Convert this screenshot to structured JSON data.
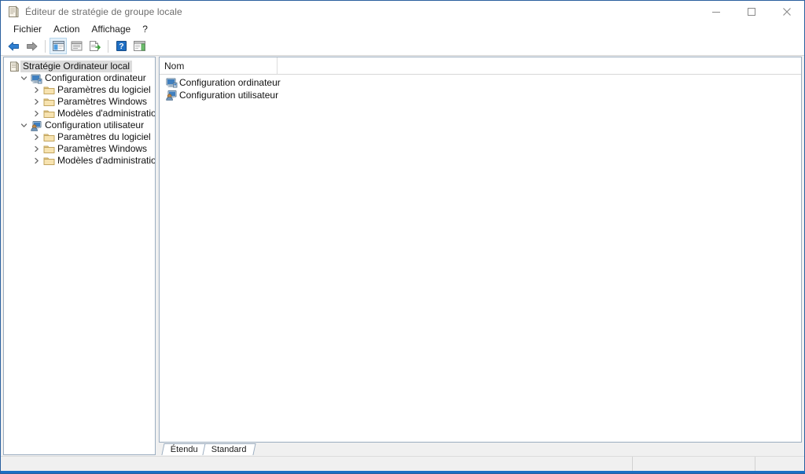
{
  "window": {
    "title": "Éditeur de stratégie de groupe locale",
    "title_icon": "policy-document-icon",
    "controls": {
      "minimize": "minimize-icon",
      "maximize": "maximize-icon",
      "close": "close-icon"
    }
  },
  "menubar": {
    "items": [
      {
        "label": "Fichier"
      },
      {
        "label": "Action"
      },
      {
        "label": "Affichage"
      },
      {
        "label": "?"
      }
    ]
  },
  "toolbar": {
    "buttons": [
      {
        "name": "back-arrow-icon",
        "label": "Précédent"
      },
      {
        "name": "forward-arrow-icon",
        "label": "Suivant"
      },
      {
        "name": "show-hide-tree-icon",
        "label": "Afficher/Masquer l'arborescence"
      },
      {
        "name": "properties-icon",
        "label": "Propriétés"
      },
      {
        "name": "export-list-icon",
        "label": "Exporter la liste"
      },
      {
        "name": "help-icon",
        "label": "Aide"
      },
      {
        "name": "show-action-pane-icon",
        "label": "Afficher le volet Actions"
      }
    ]
  },
  "tree": {
    "nodes": [
      {
        "label": "Stratégie Ordinateur local",
        "icon": "policy-document-icon",
        "indent": 0,
        "twisty": "none",
        "selected": true
      },
      {
        "label": "Configuration ordinateur",
        "icon": "computer-config-icon",
        "indent": 1,
        "twisty": "expanded",
        "selected": false
      },
      {
        "label": "Paramètres du logiciel",
        "icon": "folder-icon",
        "indent": 2,
        "twisty": "collapsed",
        "selected": false
      },
      {
        "label": "Paramètres Windows",
        "icon": "folder-icon",
        "indent": 2,
        "twisty": "collapsed",
        "selected": false
      },
      {
        "label": "Modèles d'administration",
        "icon": "folder-icon",
        "indent": 2,
        "twisty": "collapsed",
        "selected": false
      },
      {
        "label": "Configuration utilisateur",
        "icon": "user-config-icon",
        "indent": 1,
        "twisty": "expanded",
        "selected": false
      },
      {
        "label": "Paramètres du logiciel",
        "icon": "folder-icon",
        "indent": 2,
        "twisty": "collapsed",
        "selected": false
      },
      {
        "label": "Paramètres Windows",
        "icon": "folder-icon",
        "indent": 2,
        "twisty": "collapsed",
        "selected": false
      },
      {
        "label": "Modèles d'administration",
        "icon": "folder-icon",
        "indent": 2,
        "twisty": "collapsed",
        "selected": false
      }
    ]
  },
  "list": {
    "columns": [
      {
        "label": "Nom"
      },
      {
        "label": ""
      }
    ],
    "rows": [
      {
        "name": "Configuration ordinateur",
        "icon": "computer-config-icon"
      },
      {
        "name": "Configuration utilisateur",
        "icon": "user-config-icon"
      }
    ]
  },
  "tabs": {
    "items": [
      {
        "label": "Étendu",
        "active": false
      },
      {
        "label": "Standard",
        "active": true
      }
    ]
  },
  "statusbar": {
    "segments": [
      "",
      "",
      ""
    ]
  },
  "colors": {
    "window_border": "#2a5f9e",
    "pane_border": "#9badc0",
    "selection": "#dcdcdc",
    "toolbar_active": "#e3f0fa",
    "accent_blue": "#1a6fc4",
    "folder_yellow": "#f2d08a",
    "title_text": "#6d6d6d"
  }
}
